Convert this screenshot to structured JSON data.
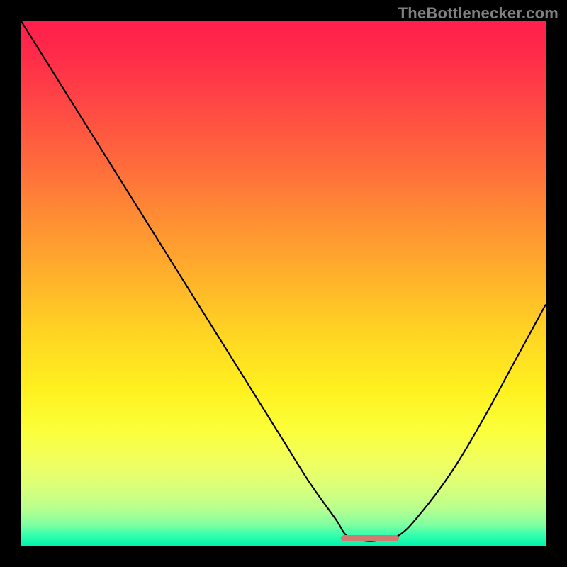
{
  "watermark": "TheBottlenecker.com",
  "chart_data": {
    "type": "line",
    "title": "",
    "xlabel": "",
    "ylabel": "",
    "xlim": [
      0,
      100
    ],
    "ylim": [
      0,
      100
    ],
    "grid": false,
    "legend": false,
    "background": "rainbow-vertical-gradient",
    "series": [
      {
        "name": "bottleneck-curve",
        "x": [
          0,
          5,
          10,
          15,
          20,
          25,
          30,
          35,
          40,
          45,
          50,
          55,
          60,
          62,
          65,
          68,
          72,
          76,
          82,
          88,
          94,
          100
        ],
        "y": [
          100,
          92,
          84,
          76,
          68,
          60,
          52,
          44,
          36,
          28,
          20,
          12,
          5,
          2,
          1,
          1,
          2,
          6,
          14,
          24,
          35,
          46
        ]
      }
    ],
    "annotations": [
      {
        "name": "optimal-zone-marker",
        "x_start": 61,
        "x_end": 72,
        "y": 1.5,
        "color": "#d07a72"
      }
    ]
  }
}
